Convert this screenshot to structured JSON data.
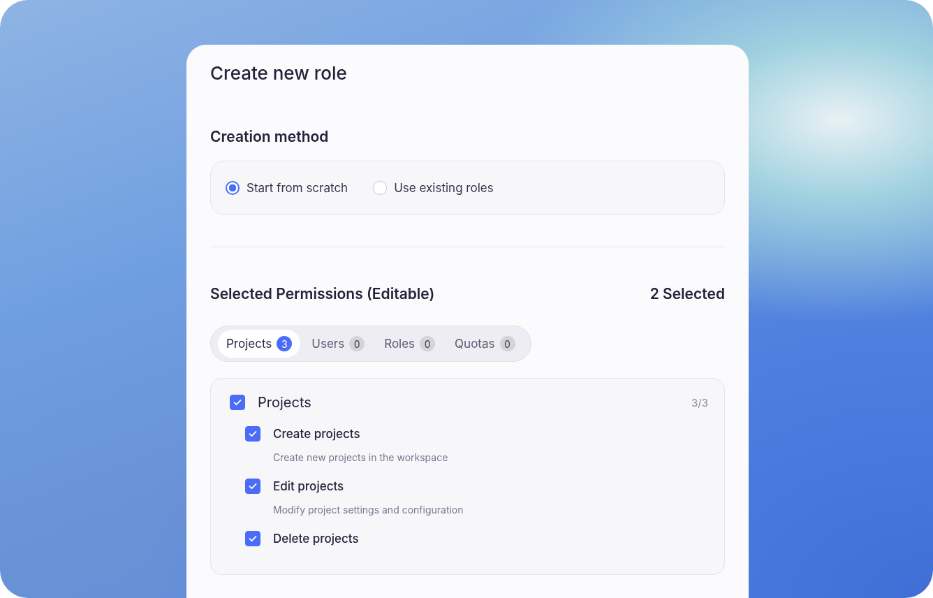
{
  "dialog": {
    "title": "Create new role"
  },
  "creation_method": {
    "heading": "Creation method",
    "options": [
      {
        "label": "Start from scratch",
        "selected": true
      },
      {
        "label": "Use existing roles",
        "selected": false
      }
    ]
  },
  "permissions": {
    "heading": "Selected Permissions (Editable)",
    "count": "2 Selected",
    "tabs": [
      {
        "label": "Projects",
        "badge": "3",
        "selected": true
      },
      {
        "label": "Users",
        "badge": "0",
        "selected": false
      },
      {
        "label": "Roles",
        "badge": "0",
        "selected": false
      },
      {
        "label": "Quotas",
        "badge": "0",
        "selected": false
      }
    ],
    "group": {
      "label": "Projects",
      "checked": true,
      "tally": "3/3",
      "items": [
        {
          "label": "Create projects",
          "description": "Create new projects in the workspace",
          "checked": true
        },
        {
          "label": "Edit projects",
          "description": "Modify project settings and configuration",
          "checked": true
        },
        {
          "label": "Delete projects",
          "checked": true
        }
      ]
    }
  }
}
